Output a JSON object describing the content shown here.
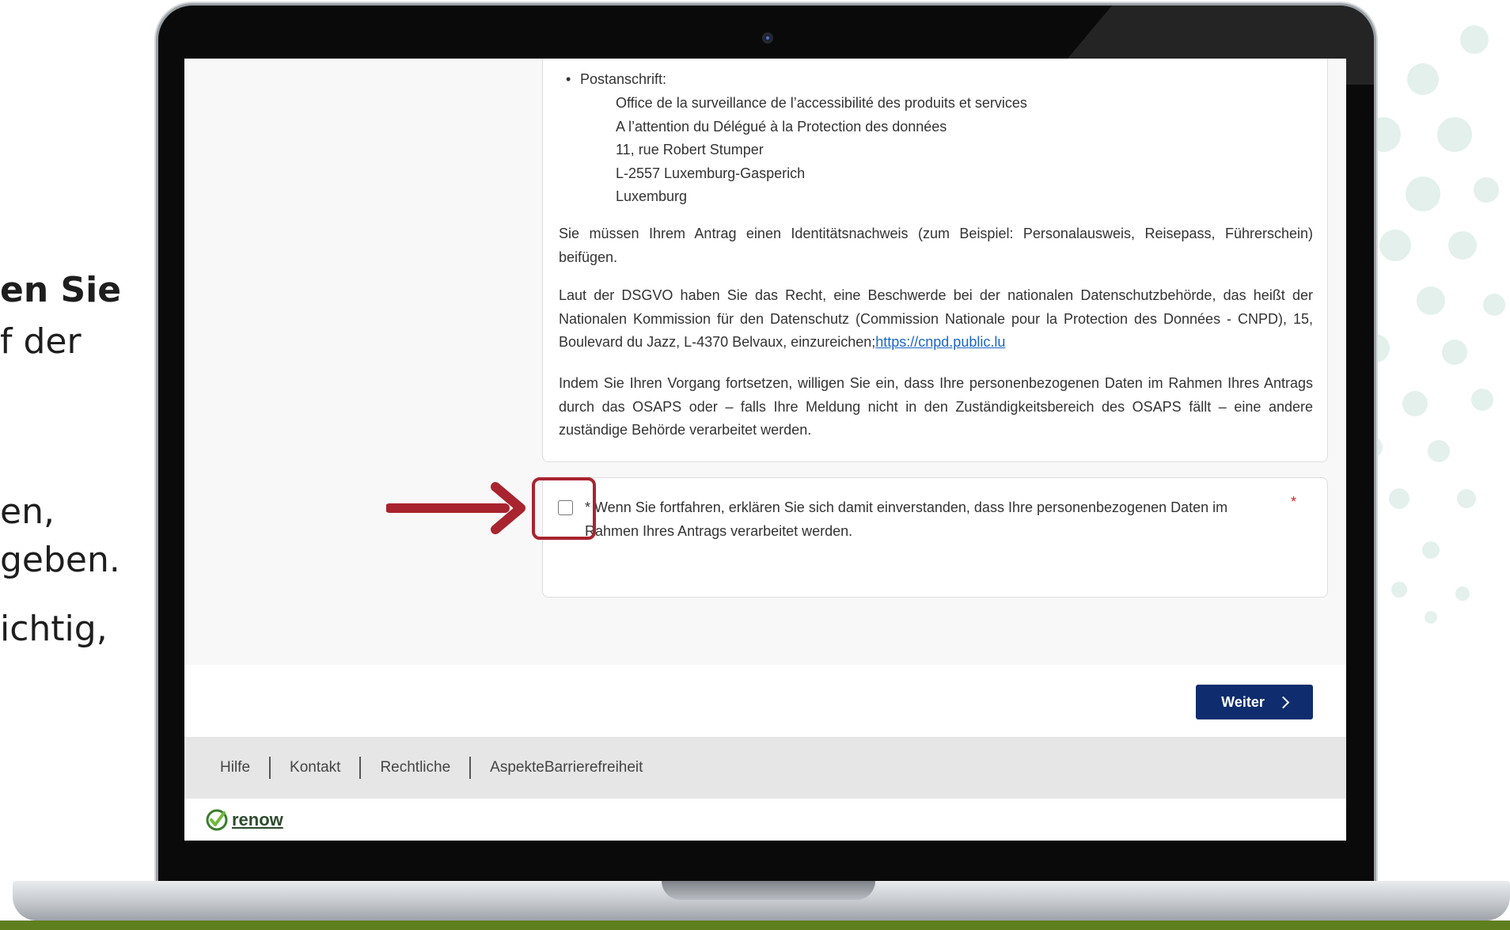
{
  "background_text": [
    "en Sie",
    "f der",
    "en,",
    "geben.",
    "ichtig,"
  ],
  "address": {
    "label": "Postanschrift:",
    "lines": [
      "Office de la surveillance de l’accessibilité des produits et services",
      "A l’attention du Délégué à la Protection des données",
      "11, rue Robert Stumper",
      "L-2557 Luxemburg-Gasperich",
      "Luxemburg"
    ]
  },
  "paragraphs": {
    "identity": "Sie müssen Ihrem Antrag einen Identitätsnachweis (zum Beispiel: Personalausweis, Reisepass, Führerschein) beifügen.",
    "complaint": "Laut der DSGVO haben Sie das Recht, eine Beschwerde bei der nationalen Datenschutzbehörde, das heißt der Nationalen Kommission für den Datenschutz (Commission Nationale pour la Protection des Données - CNPD), 15, Boulevard du Jazz, L-4370 Belvaux, einzureichen;",
    "complaint_link": "https://cnpd.public.lu",
    "consent_info": "Indem Sie Ihren Vorgang fortsetzen, willigen Sie ein, dass Ihre personenbezogenen Daten im Rahmen Ihres Antrags durch das OSAPS oder – falls Ihre Meldung nicht in den Zuständigkeitsbereich des OSAPS fällt – eine andere zuständige Behörde verarbeitet werden."
  },
  "consent": {
    "text": "* Wenn Sie fortfahren, erklären Sie sich damit einverstanden, dass Ihre personenbezogenen Daten im Rahmen Ihres Antrags verarbeitet werden.",
    "required_marker": "*",
    "checked": false
  },
  "buttons": {
    "next": "Weiter"
  },
  "footer": {
    "links": [
      "Hilfe",
      "Kontakt",
      "Rechtliche",
      "AspekteBarrierefreiheit"
    ]
  },
  "logo": {
    "text": "renow"
  },
  "colors": {
    "primary_button": "#0f2d6e",
    "link": "#1a66c9",
    "annotation": "#a8242e",
    "required": "#d42020",
    "footer_bg": "#e6e6e6"
  }
}
